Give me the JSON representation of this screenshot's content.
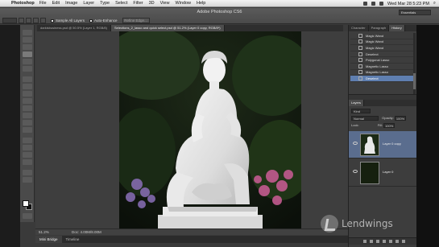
{
  "menubar": {
    "app_name": "Photoshop",
    "menus": [
      "File",
      "Edit",
      "Image",
      "Layer",
      "Type",
      "Select",
      "Filter",
      "3D",
      "View",
      "Window",
      "Help"
    ],
    "clock": "Wed Mar 28  5:23 PM"
  },
  "window": {
    "title": "Adobe Photoshop CS6",
    "workspace": "Essentials"
  },
  "options": {
    "sample_all_layers": "Sample All Layers",
    "auto_enhance": "Auto-Enhance",
    "refine_edge": "Refine Edge..."
  },
  "tabs": [
    "darkisbusiness.psd @ 50.5% (Layer 1, RGB/8)",
    "Selections_2_lasso and quick select.psd @ 51.2% (Layer 0 copy, RGB/8*)"
  ],
  "status": {
    "zoom": "51.2%",
    "doc": "Doc: 4.00M/8.00M"
  },
  "bottom_tabs": [
    "Mini Bridge",
    "Timeline"
  ],
  "history": {
    "tabs": [
      "Character",
      "Paragraph",
      "History"
    ],
    "items": [
      "Magic Wand",
      "Magic Wand",
      "Magic Wand",
      "Deselect",
      "Polygonal Lasso",
      "Magnetic Lasso",
      "Magnetic Lasso",
      "Deselect"
    ],
    "selected_index": 7
  },
  "layers": {
    "tab": "Layers",
    "kind": "Kind",
    "blend": "Normal",
    "opacity_label": "Opacity:",
    "opacity": "100%",
    "lock_label": "Lock:",
    "fill_label": "Fill:",
    "fill": "100%",
    "items": [
      {
        "name": "Layer 0 copy",
        "selected": true
      },
      {
        "name": "Layer 0",
        "selected": false
      }
    ]
  },
  "watermark": {
    "text": "Lendwings"
  }
}
